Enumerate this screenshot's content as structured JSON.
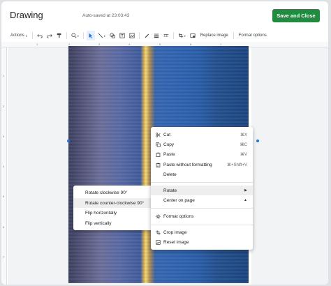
{
  "app": {
    "title": "Drawing",
    "autosave": "Auto-saved at 23:03:43",
    "save_close": "Save and Close"
  },
  "toolbar": {
    "actions": "Actions",
    "replace_image": "Replace image",
    "format_options": "Format options"
  },
  "ruler": {
    "top": [
      "1",
      "2",
      "3",
      "4",
      "5",
      "6",
      "7"
    ],
    "left": [
      "1",
      "2",
      "3",
      "4",
      "5",
      "6",
      "7"
    ]
  },
  "context_menu": {
    "cut": {
      "label": "Cut",
      "shortcut": "⌘X"
    },
    "copy": {
      "label": "Copy",
      "shortcut": "⌘C"
    },
    "paste": {
      "label": "Paste",
      "shortcut": "⌘V"
    },
    "paste_nf": {
      "label": "Paste without formatting",
      "shortcut": "⌘+Shift+V"
    },
    "delete": {
      "label": "Delete"
    },
    "rotate": {
      "label": "Rotate"
    },
    "center": {
      "label": "Center on page"
    },
    "format_options": {
      "label": "Format options"
    },
    "crop": {
      "label": "Crop image"
    },
    "reset": {
      "label": "Reset image"
    }
  },
  "rotate_submenu": [
    "Rotate clockwise 90°",
    "Rotate counter-clockwise 90°",
    "Flip horizontally",
    "Flip vertically"
  ],
  "colors": {
    "save_button": "#1e8e3e",
    "selection_handle": "#1a73e8"
  }
}
